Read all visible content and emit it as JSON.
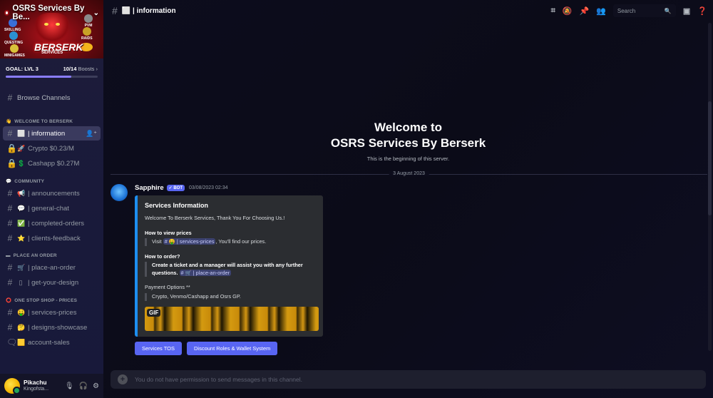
{
  "server": {
    "name": "OSRS Services By Be...",
    "banner_logo": "BERSERK",
    "banner_sub": "SERVICES",
    "badges": [
      "SKILLING",
      "PVM",
      "QUESTING",
      "RAIDS",
      "MINIGAMES"
    ]
  },
  "boost": {
    "goal": "GOAL: LVL 3",
    "count": "10/14",
    "label": "Boosts",
    "progress_percent": 71
  },
  "browse": "Browse Channels",
  "categories": [
    {
      "name": "WELCOME TO BERSERK",
      "emoji": "👋",
      "channels": [
        {
          "emoji": "⬜",
          "label": "| information",
          "active": true,
          "locked": false
        },
        {
          "emoji": "🚀",
          "label": "Crypto $0.23/M",
          "active": false,
          "locked": true
        },
        {
          "emoji": "💲",
          "label": "Cashapp $0.27M",
          "active": false,
          "locked": true
        }
      ]
    },
    {
      "name": "COMMUNITY",
      "emoji": "💬",
      "channels": [
        {
          "emoji": "📢",
          "label": "| announcements"
        },
        {
          "emoji": "💬",
          "label": "| general-chat"
        },
        {
          "emoji": "✅",
          "label": "| completed-orders"
        },
        {
          "emoji": "⭐",
          "label": "| clients-feedback"
        }
      ]
    },
    {
      "name": "PLACE AN ORDER",
      "emoji": "▬",
      "channels": [
        {
          "emoji": "🛒",
          "label": "| place-an-order"
        },
        {
          "emoji": "▯",
          "label": "| get-your-design"
        }
      ]
    },
    {
      "name": "ONE STOP SHOP - PRICES",
      "emoji": "⭕",
      "channels": [
        {
          "emoji": "🤑",
          "label": "| services-prices"
        },
        {
          "emoji": "🤔",
          "label": "| designs-showcase"
        },
        {
          "emoji": "🟨",
          "label": "account-sales"
        }
      ]
    }
  ],
  "user": {
    "name": "Pikachu",
    "status": "Kingofsta..."
  },
  "topbar": {
    "channel": "⬜ | information",
    "search_placeholder": "Search"
  },
  "welcome": {
    "line1": "Welcome to",
    "line2": "OSRS Services By Berserk",
    "sub": "This is the beginning of this server."
  },
  "date_divider": "3 August 2023",
  "message": {
    "author": "Sapphire",
    "bot_tag": "✓ BOT",
    "time": "03/08/2023 02:34",
    "embed": {
      "title": "Services Information",
      "intro": "Welcome To Berserk Services, Thank You For Choosing Us.!",
      "view_heading": "How to view prices",
      "view_pre": "Visit",
      "view_mention": "# 🤑 | services-prices",
      "view_post": ", You'll find our prices.",
      "order_heading": "How to order?",
      "order_text": "Create a ticket and a manager will assist you with any further questions.",
      "order_mention": "# 🛒 | place-an-order",
      "payment_heading": "Payment Options **",
      "payment_text": "Crypto, Venmo/Cashapp and Osrs GP.",
      "gif_tag": "GIF"
    },
    "buttons": [
      "Services TOS",
      "Discount Roles & Wallet System"
    ]
  },
  "composer_placeholder": "You do not have permission to send messages in this channel."
}
